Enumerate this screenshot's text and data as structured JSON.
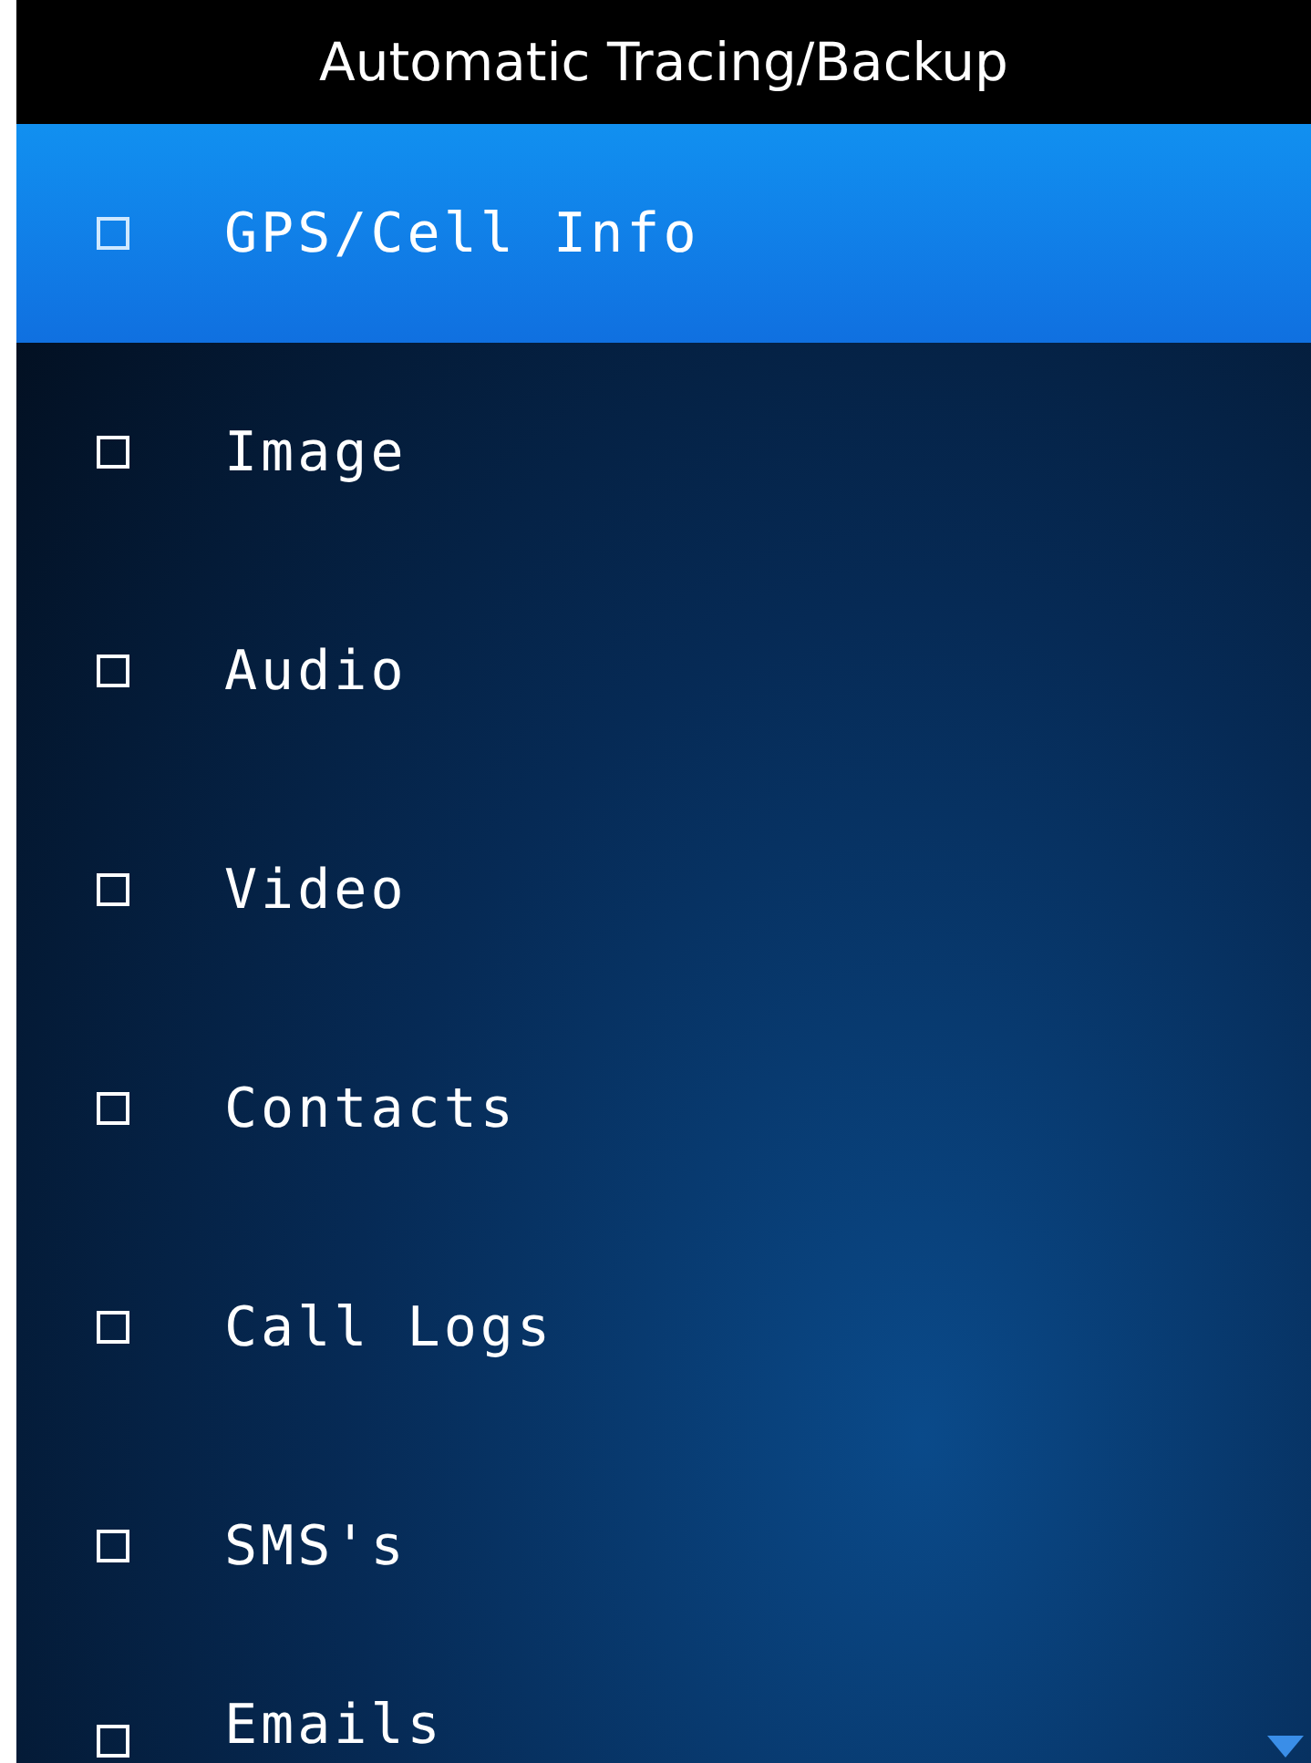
{
  "window": {
    "title": "Automatic Tracing/Backup"
  },
  "items": [
    {
      "label": "GPS/Cell Info",
      "checked": false,
      "selected": true
    },
    {
      "label": "Image",
      "checked": false,
      "selected": false
    },
    {
      "label": "Audio",
      "checked": false,
      "selected": false
    },
    {
      "label": "Video",
      "checked": false,
      "selected": false
    },
    {
      "label": "Contacts",
      "checked": false,
      "selected": false
    },
    {
      "label": "Call Logs",
      "checked": false,
      "selected": false
    },
    {
      "label": "SMS's",
      "checked": false,
      "selected": false
    },
    {
      "label": "Emails",
      "checked": false,
      "selected": false
    }
  ]
}
